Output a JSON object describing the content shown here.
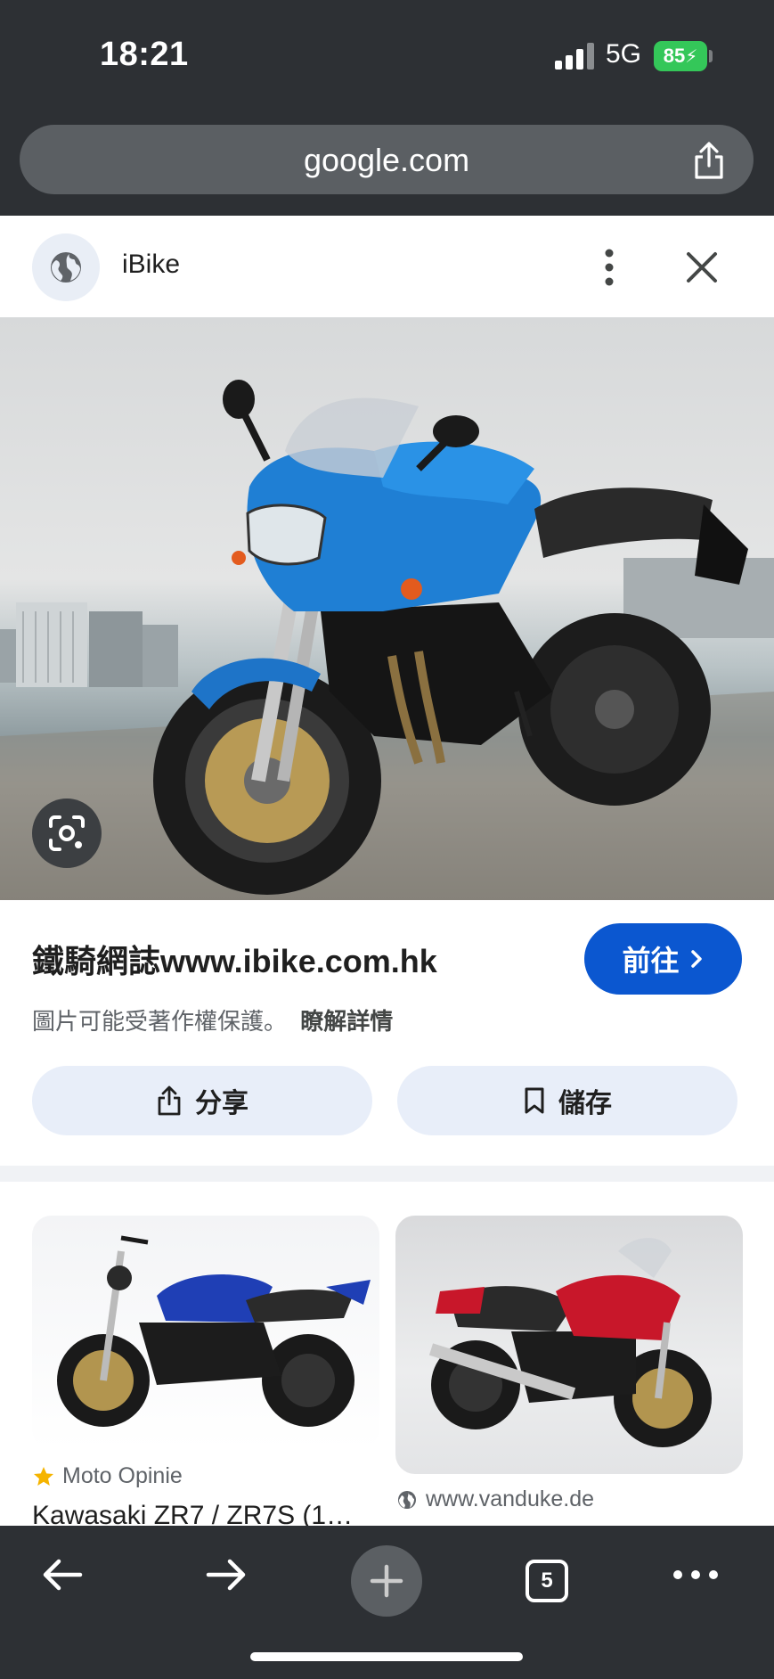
{
  "status": {
    "time": "18:21",
    "network": "5G",
    "battery": "85"
  },
  "browser": {
    "url": "google.com"
  },
  "panel": {
    "site_name": "iBike"
  },
  "result": {
    "title": "鐵騎網誌www.ibike.com.hk",
    "visit_label": "前往",
    "copyright_text": "圖片可能受著作權保護。",
    "learn_more": "瞭解詳情",
    "share_label": "分享",
    "save_label": "儲存"
  },
  "related": [
    {
      "source": "Moto Opinie",
      "title": "Kawasaki ZR7 / ZR7S (1…"
    },
    {
      "source": "www.vanduke.de"
    }
  ],
  "tabs": {
    "count": "5"
  },
  "colors": {
    "accent": "#0b57d0",
    "chrome": "#2d3034",
    "battery": "#34c759"
  },
  "icons": [
    "globe-icon",
    "more-vert-icon",
    "close-icon",
    "lens-icon",
    "chevron-right-icon",
    "share-icon",
    "bookmark-icon",
    "star-icon",
    "back-icon",
    "forward-icon",
    "plus-icon",
    "more-horiz-icon"
  ]
}
